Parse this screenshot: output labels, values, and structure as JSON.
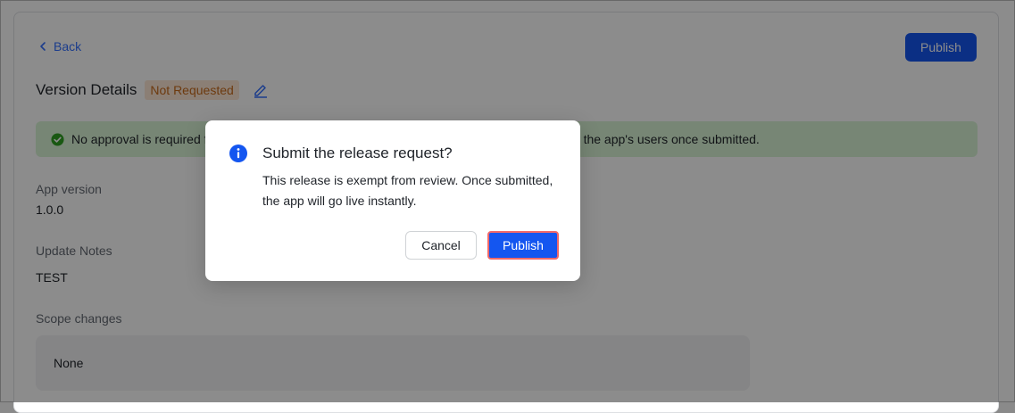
{
  "header": {
    "back_label": "Back",
    "publish_label": "Publish"
  },
  "version": {
    "title": "Version Details",
    "status_badge": "Not Requested"
  },
  "banner": {
    "text_left": "No approval is required f",
    "text_right": "to the app's users once submitted."
  },
  "fields": {
    "app_version_label": "App version",
    "app_version_value": "1.0.0",
    "update_notes_label": "Update Notes",
    "update_notes_value": "TEST",
    "scope_changes_label": "Scope changes",
    "scope_changes_value": "None"
  },
  "dialog": {
    "title": "Submit the release request?",
    "body": "This release is exempt from review. Once submitted, the app will go live instantly.",
    "cancel_label": "Cancel",
    "confirm_label": "Publish"
  },
  "colors": {
    "primary": "#1456f0",
    "link": "#3370ff",
    "success_bg": "#d9f5d6",
    "badge_bg": "#fde8d6",
    "badge_text": "#c76a1b",
    "highlight_border": "#f16969"
  }
}
